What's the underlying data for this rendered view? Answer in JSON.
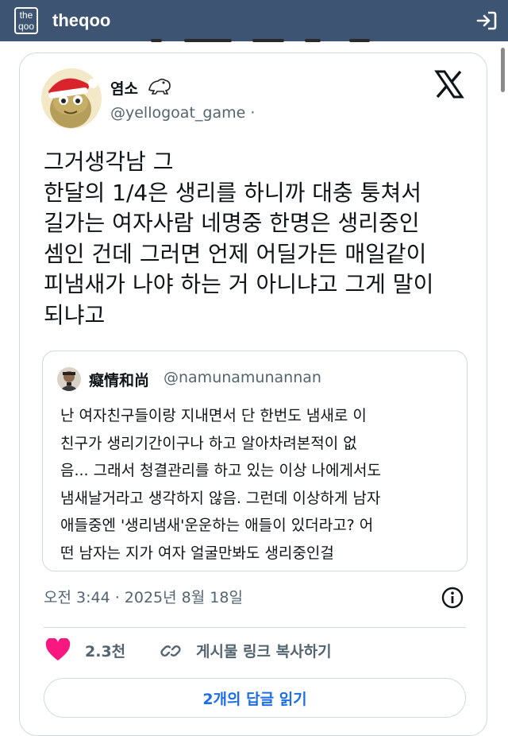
{
  "app": {
    "logo_top": "the",
    "logo_bottom": "qoo",
    "site_name": "theqoo"
  },
  "tweet": {
    "author_name": "염소",
    "handle": "@yellogoat_game ·",
    "text_lines": [
      "그거생각남 그",
      "한달의 1/4은 생리를 하니까 대충 퉁쳐서",
      "길가는 여자사람 네명중 한명은 생리중인",
      "셈인 건데 그러면 언제 어딜가든 매일같이",
      "피냄새가 나야 하는 거 아니냐고 그게 말이",
      "되냐고"
    ],
    "quote": {
      "author_name": "癡情和尚",
      "handle": "@namunamunannan",
      "text_lines": [
        "난 여자친구들이랑 지내면서 단  한번도 냄새로 이",
        "친구가 생리기간이구나 하고 알아차려본적이 없",
        "음... 그래서 청결관리를 하고 있는 이상 나에게서도",
        "냄새날거라고 생각하지 않음. 그런데 이상하게 남자",
        "애들중엔 '생리냄새'운운하는 애들이 있더라고? 어",
        "떤 남자는 지가 여자 얼굴만봐도 생리중인걸"
      ]
    },
    "timestamp": "오전 3:44 · 2025년 8월 18일",
    "likes": "2.3천",
    "copy_link_label": "게시물 링크 복사하기",
    "replies_button_label": "2개의 답글 읽기"
  },
  "icons": {
    "login": "login-icon",
    "x_logo": "x-logo-icon",
    "info": "info-icon",
    "heart": "heart-icon",
    "link": "link-icon"
  },
  "colors": {
    "header_bg": "#3d5572",
    "heart": "#f91880",
    "link_blue": "#1d6ee6",
    "muted_text": "#536471",
    "border": "#cfd9de"
  }
}
